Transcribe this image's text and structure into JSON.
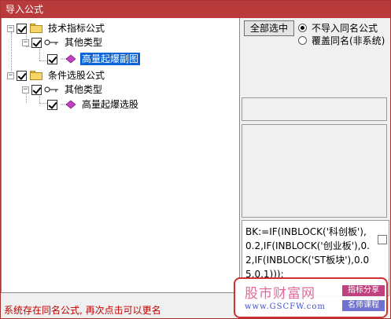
{
  "window": {
    "title": "导入公式"
  },
  "tree": {
    "nodes": [
      {
        "label": "技术指标公式"
      },
      {
        "label": "其他类型"
      },
      {
        "label": "高量起爆副图"
      },
      {
        "label": "条件选股公式"
      },
      {
        "label": "其他类型"
      },
      {
        "label": "高量起爆选股"
      }
    ]
  },
  "right_panel": {
    "select_all_button": "全部选中",
    "options": [
      {
        "label": "不导入同名公式",
        "checked": true
      },
      {
        "label": "覆盖同名(非系统)",
        "checked": false
      }
    ],
    "formula_text": "BK:=IF(INBLOCK('科创板'),0.2,IF(INBLOCK('创业板'),0.2,IF(INBLOCK('ST板块'),0.05,0.1)));"
  },
  "status": {
    "message": "系统存在同名公式, 再次点击可以更名"
  },
  "watermark": {
    "title": "股市财富网",
    "url": "www.GSCFW.com",
    "tag1": "指标分享",
    "tag2": "名师课程"
  }
}
